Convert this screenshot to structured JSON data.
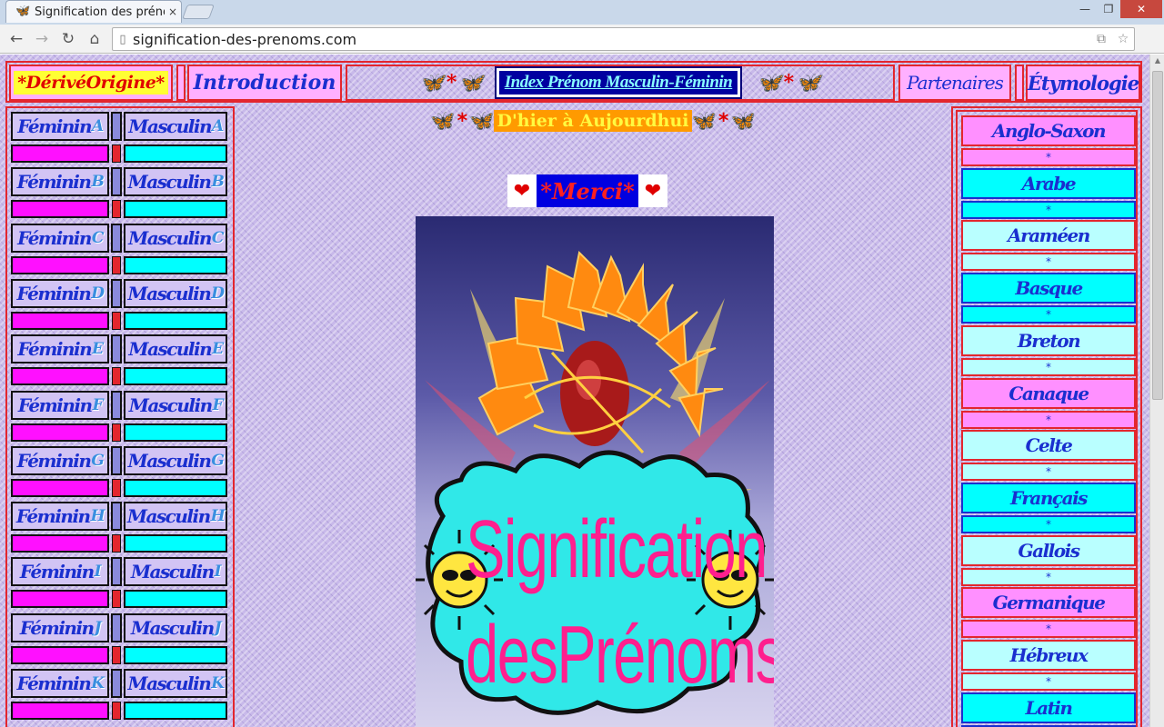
{
  "browser": {
    "tab_title": "Signification des prénoms",
    "url": "signification-des-prenoms.com",
    "close_glyph": "×",
    "min_glyph": "—",
    "max_glyph": "❐",
    "winclose_glyph": "✕"
  },
  "topnav": {
    "derive": "*DérivéOrigine*",
    "introduction": "Introduction",
    "index": "Index Prénom Masculin-Féminin",
    "partenaires": "Partenaires",
    "etymologie": "Étymologie"
  },
  "left_sidebar": {
    "rows": [
      {
        "fem": "Féminin",
        "masc": "Masculin",
        "letter": "A"
      },
      {
        "fem": "Féminin",
        "masc": "Masculin",
        "letter": "B"
      },
      {
        "fem": "Féminin",
        "masc": "Masculin",
        "letter": "C"
      },
      {
        "fem": "Féminin",
        "masc": "Masculin",
        "letter": "D"
      },
      {
        "fem": "Féminin",
        "masc": "Masculin",
        "letter": "E"
      },
      {
        "fem": "Féminin",
        "masc": "Masculin",
        "letter": "F"
      },
      {
        "fem": "Féminin",
        "masc": "Masculin",
        "letter": "G"
      },
      {
        "fem": "Féminin",
        "masc": "Masculin",
        "letter": "H"
      },
      {
        "fem": "Féminin",
        "masc": "Masculin",
        "letter": "I"
      },
      {
        "fem": "Féminin",
        "masc": "Masculin",
        "letter": "J"
      },
      {
        "fem": "Féminin",
        "masc": "Masculin",
        "letter": "K"
      }
    ]
  },
  "center": {
    "hier": "D'hier à Aujourdhui",
    "merci": "*Merci*",
    "logo_line1": "Signification",
    "logo_line2": "desPrénoms"
  },
  "right_sidebar": {
    "items": [
      {
        "label": "Anglo-Saxon",
        "style": "pk"
      },
      {
        "label": "Arabe",
        "style": "cy"
      },
      {
        "label": "Araméen",
        "style": "lc"
      },
      {
        "label": "Basque",
        "style": "cy"
      },
      {
        "label": "Breton",
        "style": "lc"
      },
      {
        "label": "Canaque",
        "style": "pk"
      },
      {
        "label": "Celte",
        "style": "lc"
      },
      {
        "label": "Français",
        "style": "cy"
      },
      {
        "label": "Gallois",
        "style": "lc"
      },
      {
        "label": "Germanique",
        "style": "pk"
      },
      {
        "label": "Hébreux",
        "style": "lc"
      },
      {
        "label": "Latin",
        "style": "cy"
      }
    ],
    "separator": "*"
  },
  "icons": {
    "favicon": "butterfly-icon",
    "back": "back-arrow-icon",
    "forward": "forward-arrow-icon",
    "reload": "reload-icon",
    "home": "home-icon",
    "page": "page-icon",
    "translate": "translate-icon",
    "bookmark": "star-icon",
    "menu": "menu-icon"
  }
}
